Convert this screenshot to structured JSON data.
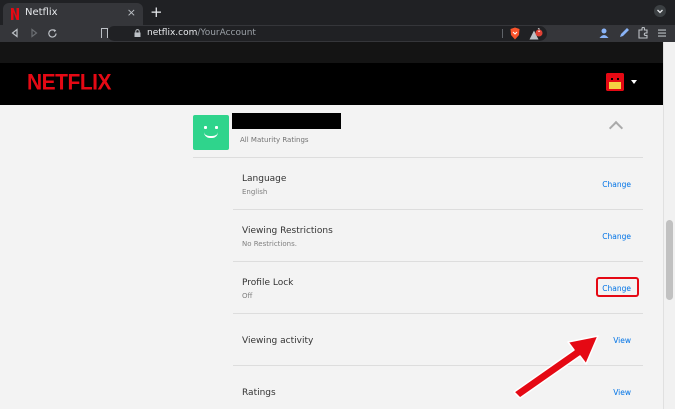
{
  "browser": {
    "tab_title": "Netflix",
    "tab_close": "×",
    "new_tab": "+",
    "url_host": "netflix.com",
    "url_path": "/YourAccount",
    "rewards_badge": "1"
  },
  "header": {
    "logo": "NETFLIX"
  },
  "profile": {
    "maturity": "All Maturity Ratings"
  },
  "settings": [
    {
      "label": "Language",
      "value": "English",
      "action": "Change"
    },
    {
      "label": "Viewing Restrictions",
      "value": "No Restrictions.",
      "action": "Change"
    },
    {
      "label": "Profile Lock",
      "value": "Off",
      "action": "Change"
    },
    {
      "label": "Viewing activity",
      "value": "",
      "action": "View"
    },
    {
      "label": "Ratings",
      "value": "",
      "action": "View"
    }
  ],
  "colors": {
    "netflix_red": "#e50914",
    "avatar_green": "#2fd48c",
    "link_blue": "#0073e6",
    "annotation_red": "#e50914"
  },
  "icons": [
    "netflix-favicon-icon",
    "back-icon",
    "forward-icon",
    "reload-icon",
    "bookmark-icon",
    "lock-icon",
    "brave-shield-icon",
    "brave-rewards-icon",
    "profile-extension-icon",
    "pen-extension-icon",
    "puzzle-icon",
    "menu-icon",
    "chevron-up-icon",
    "caret-down-icon"
  ]
}
